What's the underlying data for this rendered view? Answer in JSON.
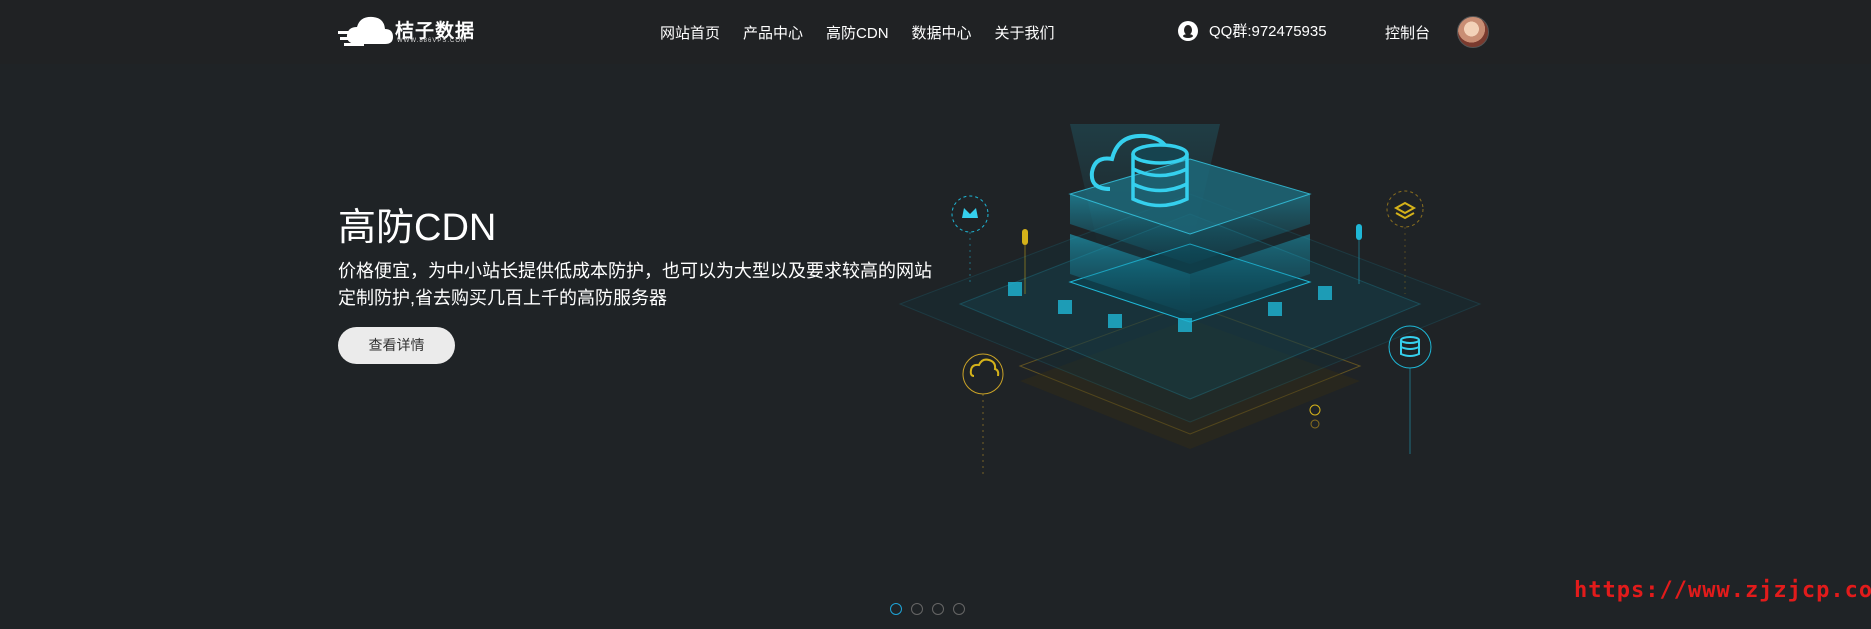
{
  "header": {
    "logo_text": "桔子数据",
    "logo_sub": "WWW.886VPS.COM",
    "nav": [
      "网站首页",
      "产品中心",
      "高防CDN",
      "数据中心",
      "关于我们"
    ],
    "qq": "QQ群:972475935",
    "console": "控制台"
  },
  "hero": {
    "title": "高防CDN",
    "description": "价格便宜，为中小站长提供低成本防护，也可以为大型以及要求较高的网站定制防护,省去购买几百上千的高防服务器",
    "button": "查看详情"
  },
  "carousel": {
    "count": 4,
    "active": 1
  },
  "watermark": "https://www.zjzjcp.com",
  "colors": {
    "background": "#1f2326",
    "accent_cyan": "#1fb7d6",
    "accent_gold": "#c9a227",
    "watermark": "#e21b1b"
  }
}
